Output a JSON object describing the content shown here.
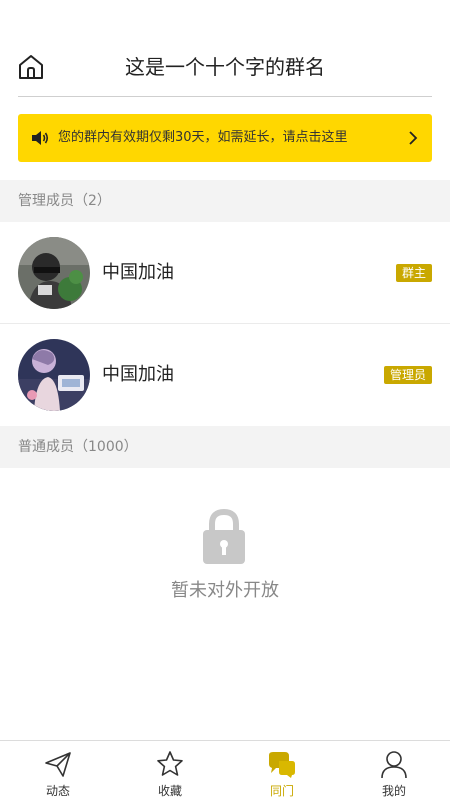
{
  "header": {
    "title": "这是一个十个字的群名",
    "home_icon": "home-icon"
  },
  "notice": {
    "text": "您的群内有效期仅剩30天，如需延长，请点击这里",
    "icon": "speaker-icon",
    "background": "#ffd700"
  },
  "sections": {
    "admins_label": "管理成员（2）",
    "regular_label": "普通成员（1000）"
  },
  "members": [
    {
      "name": "中国加油",
      "role": "群主"
    },
    {
      "name": "中国加油",
      "role": "管理员"
    }
  ],
  "locked": {
    "text": "暂未对外开放",
    "icon": "lock-icon"
  },
  "tabbar": {
    "tabs": [
      {
        "label": "动态",
        "icon": "paper-plane-icon",
        "active": false
      },
      {
        "label": "收藏",
        "icon": "star-icon",
        "active": false
      },
      {
        "label": "同门",
        "icon": "chat-bubbles-icon",
        "active": true
      },
      {
        "label": "我的",
        "icon": "person-icon",
        "active": false
      }
    ]
  },
  "colors": {
    "accent": "#c9a800",
    "notice_bg": "#ffd700",
    "section_bg": "#f3f3f3"
  }
}
